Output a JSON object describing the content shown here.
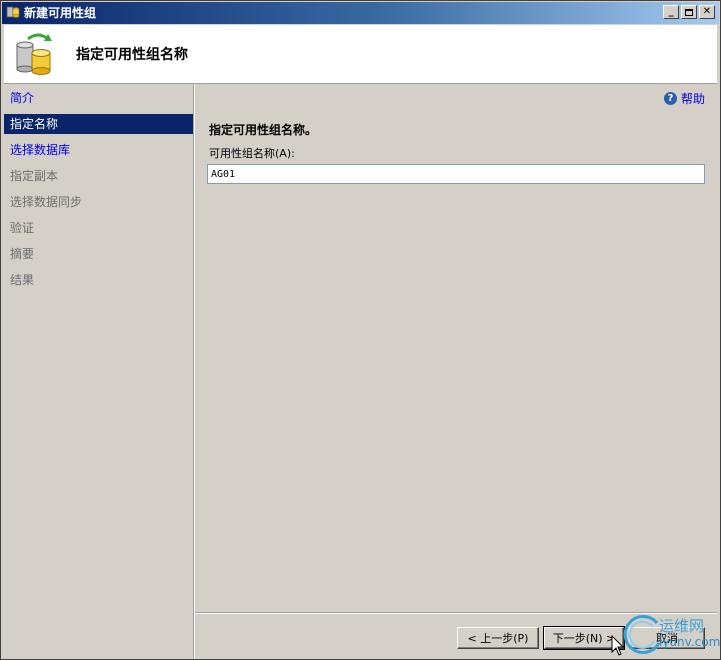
{
  "window": {
    "title": "新建可用性组"
  },
  "header": {
    "title": "指定可用性组名称"
  },
  "sidebar": {
    "items": [
      {
        "label": "简介",
        "state": "link"
      },
      {
        "label": "指定名称",
        "state": "selected"
      },
      {
        "label": "选择数据库",
        "state": "link"
      },
      {
        "label": "指定副本",
        "state": "disabled"
      },
      {
        "label": "选择数据同步",
        "state": "disabled"
      },
      {
        "label": "验证",
        "state": "disabled"
      },
      {
        "label": "摘要",
        "state": "disabled"
      },
      {
        "label": "结果",
        "state": "disabled"
      }
    ]
  },
  "main": {
    "help_label": "帮助",
    "section_title": "指定可用性组名称。",
    "field_label": "可用性组名称(A):",
    "field_value": "AG01"
  },
  "buttons": {
    "prev": "< 上一步(P)",
    "next": "下一步(N) >",
    "cancel": "取消"
  },
  "watermark": {
    "text_cn": "运维网",
    "text_url": "iyunv.com"
  },
  "colors": {
    "selected_bg": "#0a246a",
    "link": "#0000ee",
    "disabled": "#6d6d6d",
    "face": "#d4d0c8"
  }
}
